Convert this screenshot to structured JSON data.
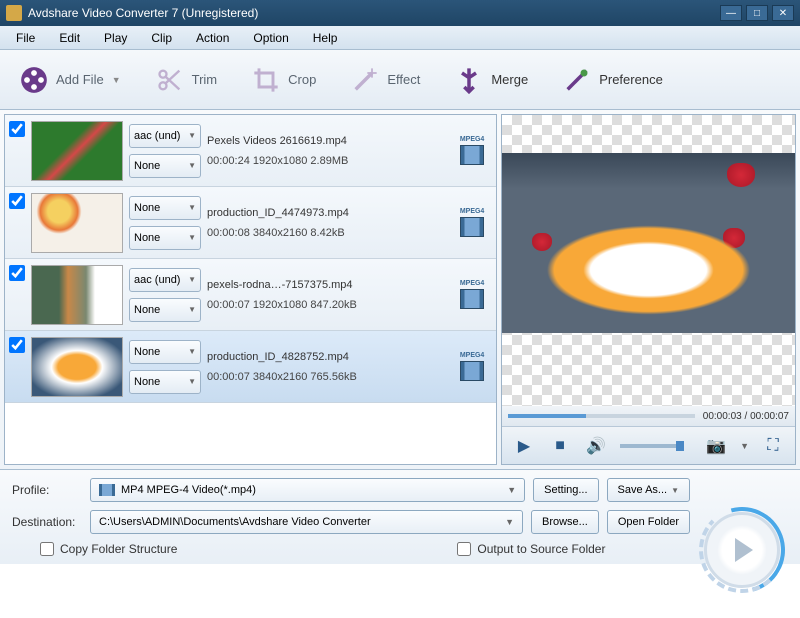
{
  "title": "Avdshare Video Converter 7 (Unregistered)",
  "menu": [
    "File",
    "Edit",
    "Play",
    "Clip",
    "Action",
    "Option",
    "Help"
  ],
  "toolbar": {
    "addFile": "Add File",
    "trim": "Trim",
    "crop": "Crop",
    "effect": "Effect",
    "merge": "Merge",
    "preference": "Preference"
  },
  "files": [
    {
      "name": "Pexels Videos 2616619.mp4",
      "duration": "00:00:24",
      "resolution": "1920x1080",
      "size": "2.89MB",
      "audio": "aac (und)",
      "output": "None",
      "format": "MPEG4"
    },
    {
      "name": "production_ID_4474973.mp4",
      "duration": "00:00:08",
      "resolution": "3840x2160",
      "size": "8.42kB",
      "audio": "None",
      "output": "None",
      "format": "MPEG4"
    },
    {
      "name": "pexels-rodna…-7157375.mp4",
      "duration": "00:00:07",
      "resolution": "1920x1080",
      "size": "847.20kB",
      "audio": "aac (und)",
      "output": "None",
      "format": "MPEG4"
    },
    {
      "name": "production_ID_4828752.mp4",
      "duration": "00:00:07",
      "resolution": "3840x2160",
      "size": "765.56kB",
      "audio": "None",
      "output": "None",
      "format": "MPEG4"
    }
  ],
  "preview": {
    "currentTime": "00:00:03",
    "totalTime": "00:00:07"
  },
  "profile": {
    "label": "Profile:",
    "value": "MP4 MPEG-4 Video(*.mp4)",
    "setting": "Setting...",
    "saveAs": "Save As..."
  },
  "destination": {
    "label": "Destination:",
    "value": "C:\\Users\\ADMIN\\Documents\\Avdshare Video Converter",
    "browse": "Browse...",
    "openFolder": "Open Folder"
  },
  "options": {
    "copyFolder": "Copy Folder Structure",
    "outputSource": "Output to Source Folder"
  }
}
